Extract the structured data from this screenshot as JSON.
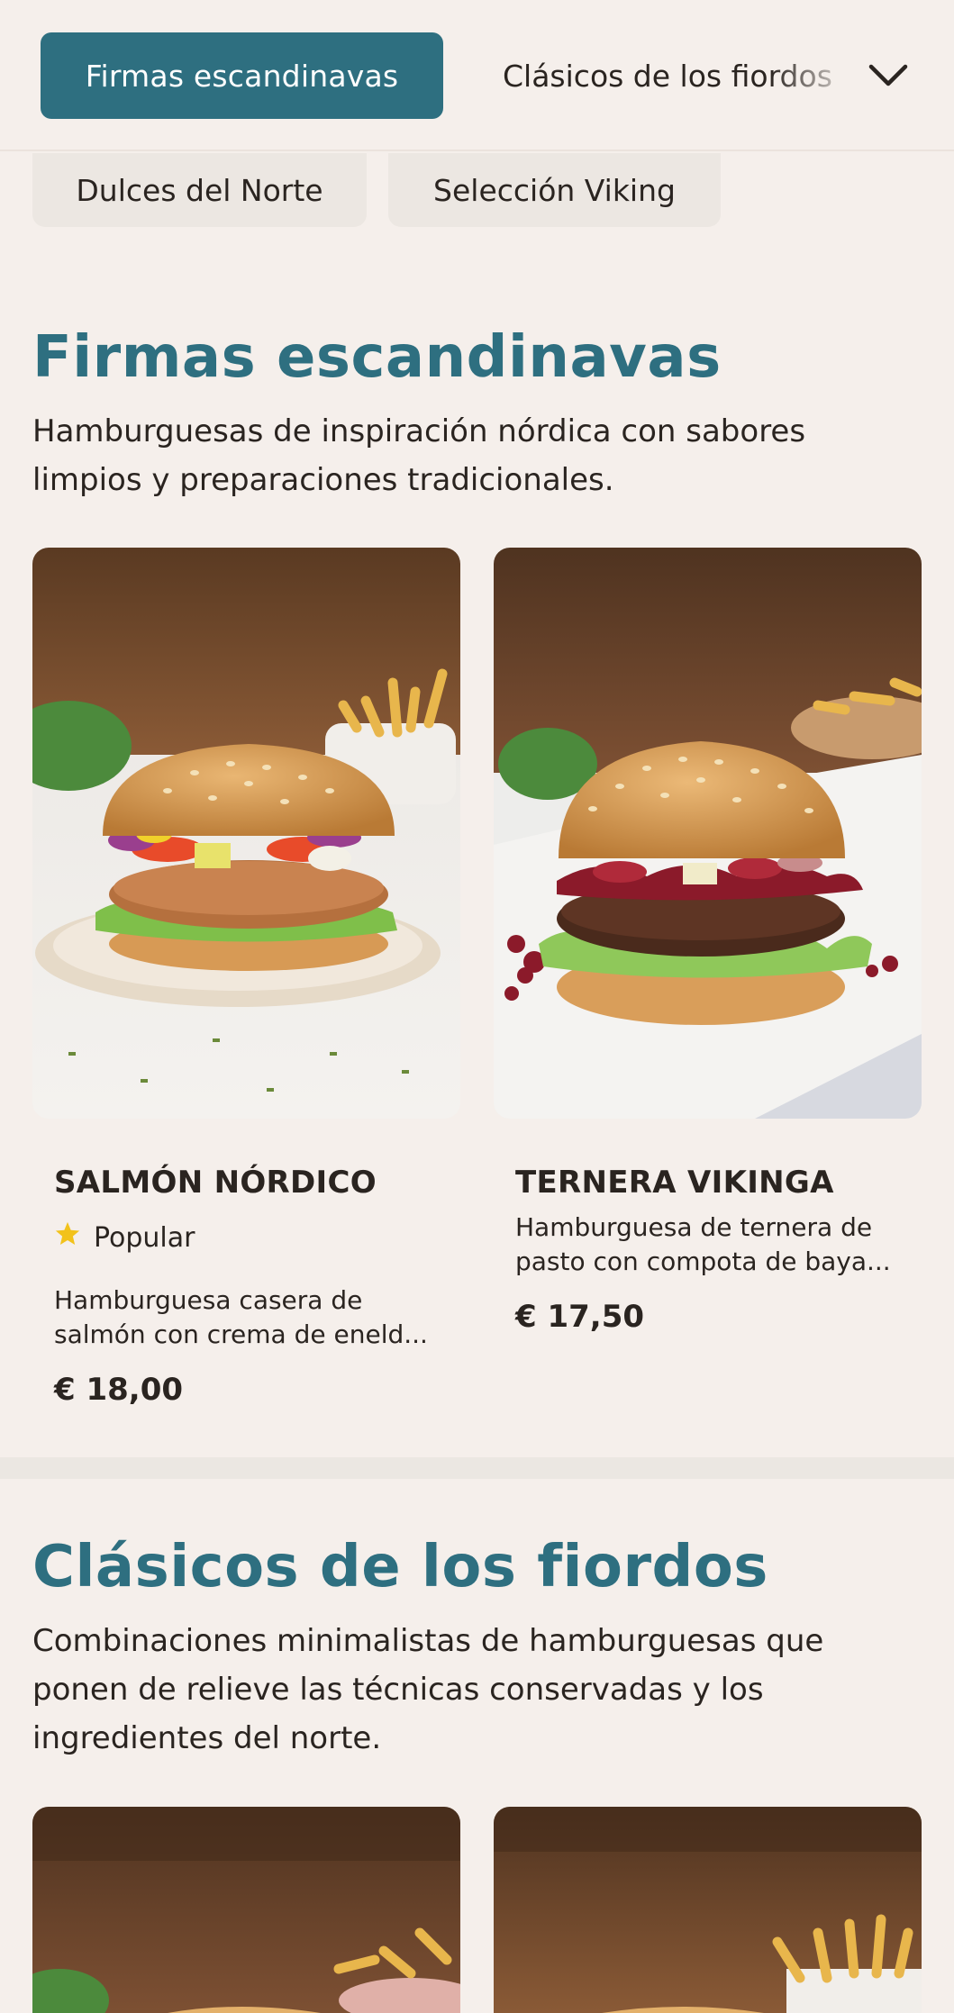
{
  "categories": {
    "active": "Firmas escandinavas",
    "next": "Clásicos de los fiordos",
    "row2": [
      "Dulces del Norte",
      "Selección Viking"
    ]
  },
  "sections": [
    {
      "title": "Firmas escandinavas",
      "description": "Hamburguesas de inspiración nórdica con sabores limpios y preparaciones tradicionales.",
      "items": [
        {
          "name": "SALMÓN NÓRDICO",
          "badge": "Popular",
          "description": "Hamburguesa casera de salmón con crema de eneld...",
          "price": "€ 18,00"
        },
        {
          "name": "TERNERA VIKINGA",
          "description": "Hamburguesa de ternera de pasto con compota de baya...",
          "price": "€ 17,50"
        }
      ]
    },
    {
      "title": "Clásicos de los fiordos",
      "description": "Combinaciones minimalistas de hamburguesas que ponen de relieve las técnicas conservadas y los ingredientes del norte."
    }
  ],
  "icons": {
    "chevron": "chevron-down-icon",
    "star": "star-icon"
  },
  "colors": {
    "accent": "#2e6f80",
    "background": "#f5efeb",
    "star": "#f2c21b"
  }
}
